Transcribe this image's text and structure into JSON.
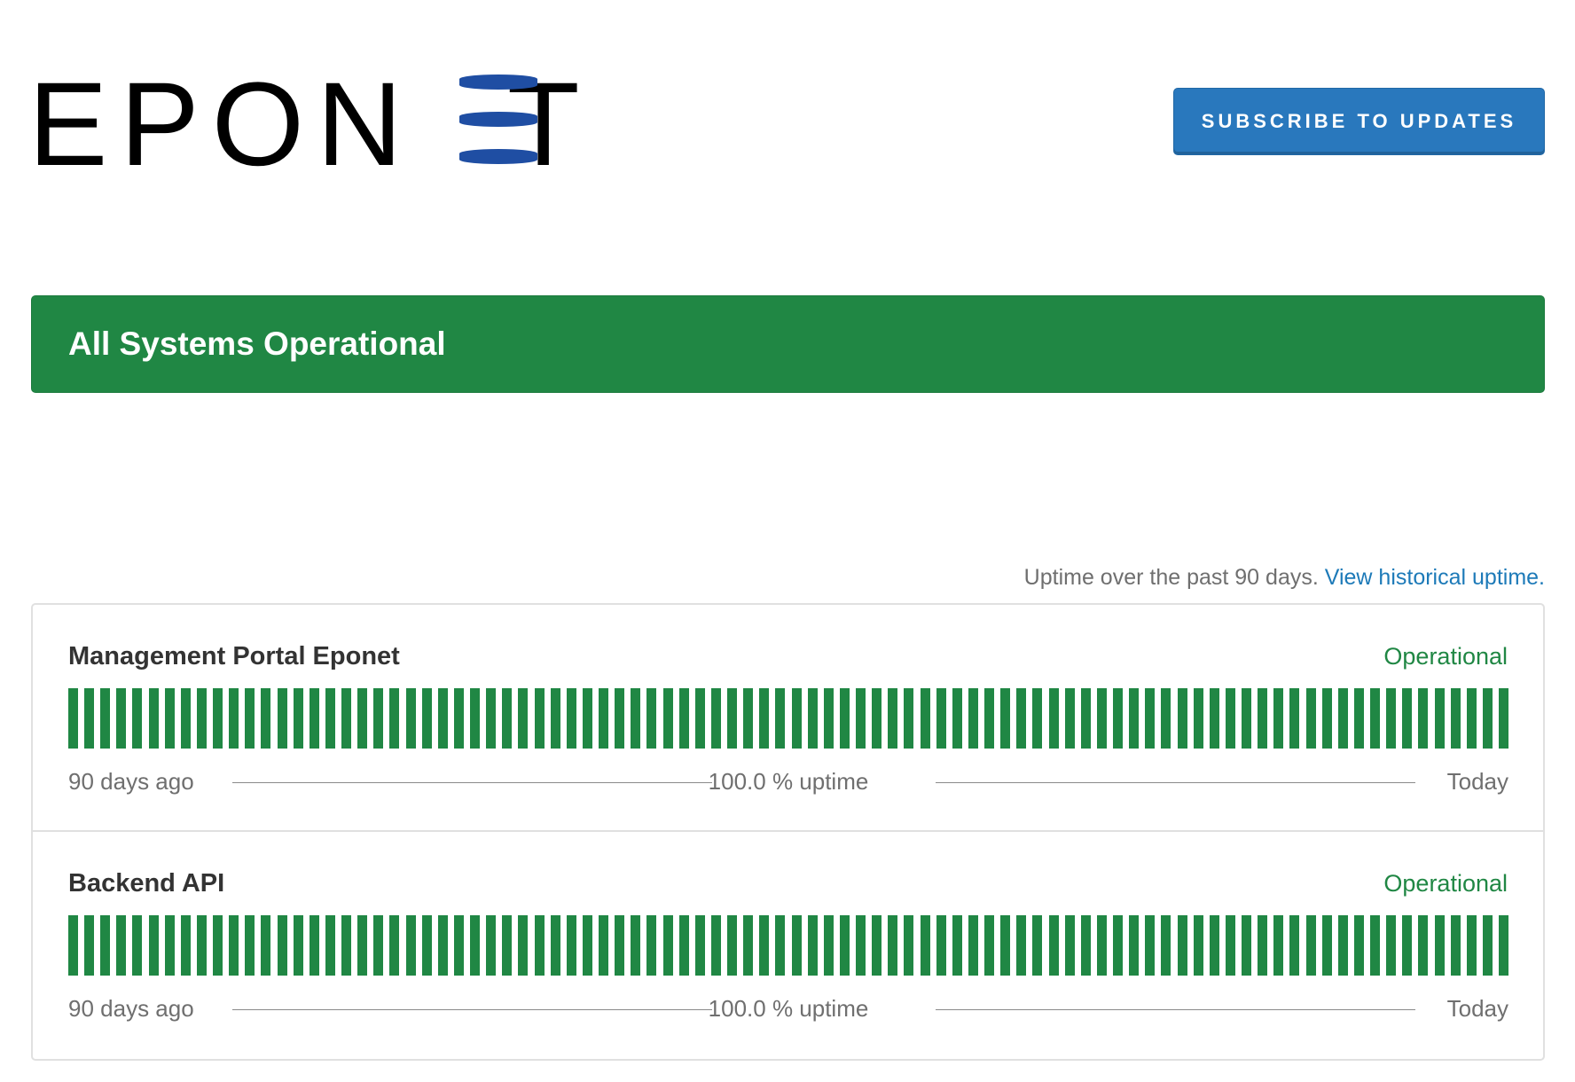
{
  "header": {
    "logo": {
      "name": "EPONET",
      "letters_before": "EPON",
      "letters_after": "T"
    },
    "subscribe_label": "SUBSCRIBE TO UPDATES"
  },
  "colors": {
    "brand_blue": "#1f4ea3",
    "button_blue": "#2978bd",
    "operational_green": "#208744",
    "link_blue": "#1d7ab8"
  },
  "status_banner": {
    "text": "All Systems Operational"
  },
  "uptime_caption": {
    "text": "Uptime over the past 90 days. ",
    "link": "View historical uptime."
  },
  "components": [
    {
      "name": "Management Portal Eponet",
      "status": "Operational",
      "days": 90,
      "uptime_percent": 100.0,
      "legend_left": "90 days ago",
      "legend_mid": "100.0 % uptime",
      "legend_right": "Today"
    },
    {
      "name": "Backend API",
      "status": "Operational",
      "days": 90,
      "uptime_percent": 100.0,
      "legend_left": "90 days ago",
      "legend_mid": "100.0 % uptime",
      "legend_right": "Today"
    }
  ]
}
